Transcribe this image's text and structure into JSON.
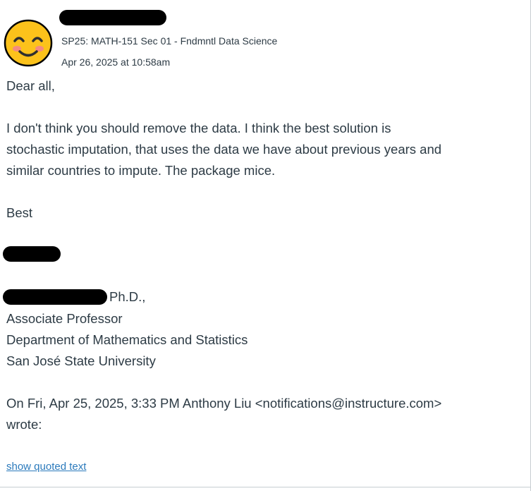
{
  "header": {
    "course": "SP25: MATH-151 Sec 01 - Fndmntl Data Science",
    "timestamp": "Apr 26, 2025 at 10:58am",
    "avatar_icon": "smiling-face-icon"
  },
  "body": {
    "greeting": "Dear all,",
    "paragraph_lines": [
      "I don't think you should remove the data. I think the best solution is",
      "stochastic imputation, that uses the data we have about previous years and",
      "similar countries to impute. The package mice."
    ],
    "closing": "Best"
  },
  "signature": {
    "suffix": "Ph.D.,",
    "lines": [
      "Associate Professor",
      "Department of Mathematics and Statistics",
      "San José State University"
    ]
  },
  "quote_header": {
    "line1": "On Fri, Apr 25, 2025, 3:33 PM Anthony Liu <notifications@instructure.com>",
    "line2": "wrote:"
  },
  "show_quoted_text": "show quoted text",
  "colors": {
    "text": "#2d3b45",
    "link": "#2b7abc",
    "avatar_face": "#fcc21b",
    "avatar_cheek": "#f48b7f"
  }
}
